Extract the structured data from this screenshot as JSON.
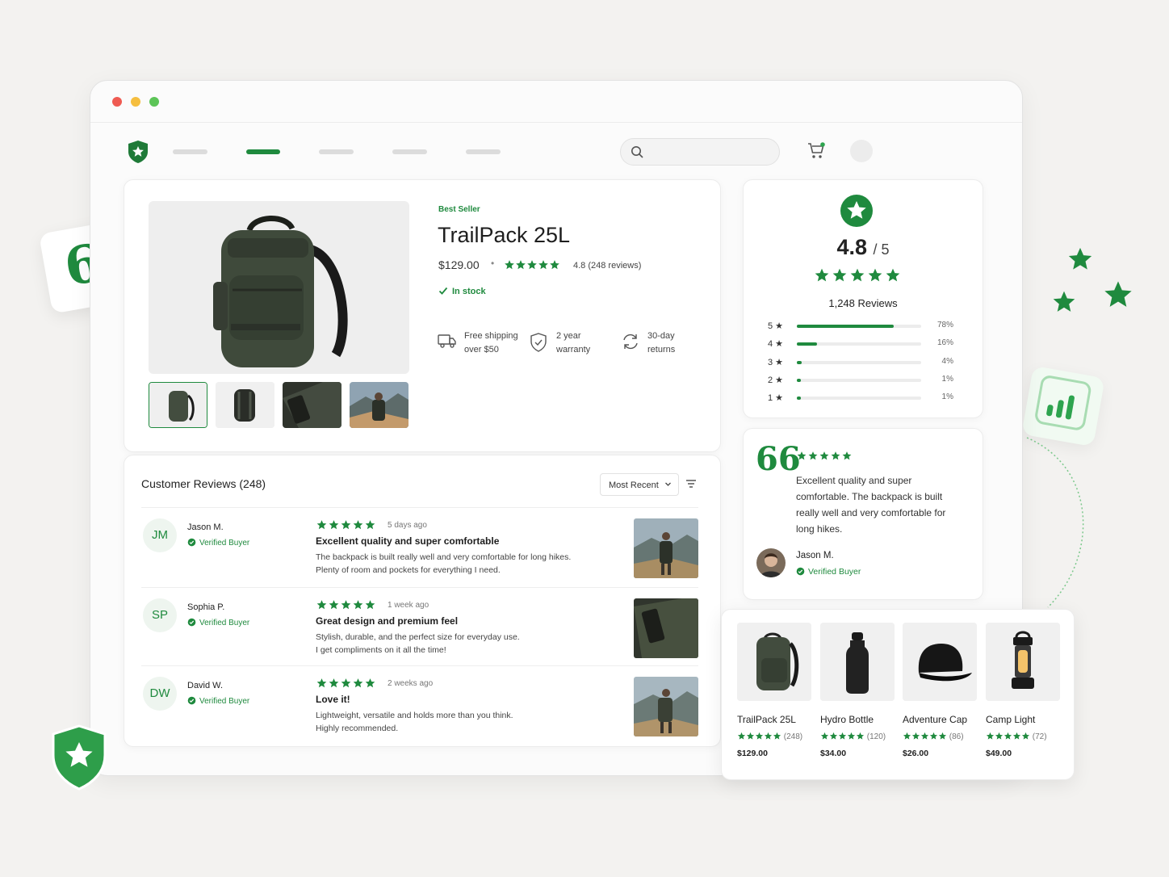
{
  "product": {
    "badge": "Best Seller",
    "title": "TrailPack 25L",
    "price": "$129.00",
    "separator": "•",
    "rating_text": "4.8 (248 reviews)",
    "stock": "In stock",
    "features": [
      {
        "line1": "Free shipping",
        "line2": "over $50",
        "icon": "truck-icon"
      },
      {
        "line1": "2 year",
        "line2": "warranty",
        "icon": "shield-check-icon"
      },
      {
        "line1": "30-day",
        "line2": "returns",
        "icon": "refresh-icon"
      }
    ]
  },
  "reviews": {
    "title": "Customer Reviews (248)",
    "sort_label": "Most Recent",
    "items": [
      {
        "initials": "JM",
        "name": "Jason M.",
        "verified": "Verified Buyer",
        "time": "5 days ago",
        "headline": "Excellent quality and super comfortable",
        "body1": "The backpack is built really well and very comfortable for long hikes.",
        "body2": "Plenty of room and pockets for everything I need."
      },
      {
        "initials": "SP",
        "name": "Sophia P.",
        "verified": "Verified Buyer",
        "time": "1 week ago",
        "headline": "Great design and premium feel",
        "body1": "Stylish, durable, and the perfect size for everyday use.",
        "body2": "I get compliments on it all the time!"
      },
      {
        "initials": "DW",
        "name": "David W.",
        "verified": "Verified Buyer",
        "time": "2 weeks ago",
        "headline": "Love it!",
        "body1": "Lightweight, versatile and holds more than you think.",
        "body2": "Highly recommended."
      }
    ]
  },
  "summary": {
    "rating": "4.8",
    "out_of": "/ 5",
    "total": "1,248 Reviews",
    "distribution": [
      {
        "label": "5 ★",
        "pct": "78%",
        "value": 78
      },
      {
        "label": "4 ★",
        "pct": "16%",
        "value": 16
      },
      {
        "label": "3 ★",
        "pct": "4%",
        "value": 4
      },
      {
        "label": "2 ★",
        "pct": "1%",
        "value": 1
      },
      {
        "label": "1 ★",
        "pct": "1%",
        "value": 1
      }
    ]
  },
  "testimonial": {
    "quote": "66",
    "body": "Excellent quality and super comfortable. The backpack is built really well and very comfortable for long hikes.",
    "name": "Jason M.",
    "verified": "Verified Buyer"
  },
  "related": [
    {
      "name": "TrailPack 25L",
      "count": "(248)",
      "price": "$129.00"
    },
    {
      "name": "Hydro Bottle",
      "count": "(120)",
      "price": "$34.00"
    },
    {
      "name": "Adventure Cap",
      "count": "(86)",
      "price": "$26.00"
    },
    {
      "name": "Camp Light",
      "count": "(72)",
      "price": "$49.00"
    }
  ],
  "decor": {
    "quote_mark": "66"
  },
  "colors": {
    "accent": "#1f8a3e",
    "background": "#f3f2f0"
  }
}
